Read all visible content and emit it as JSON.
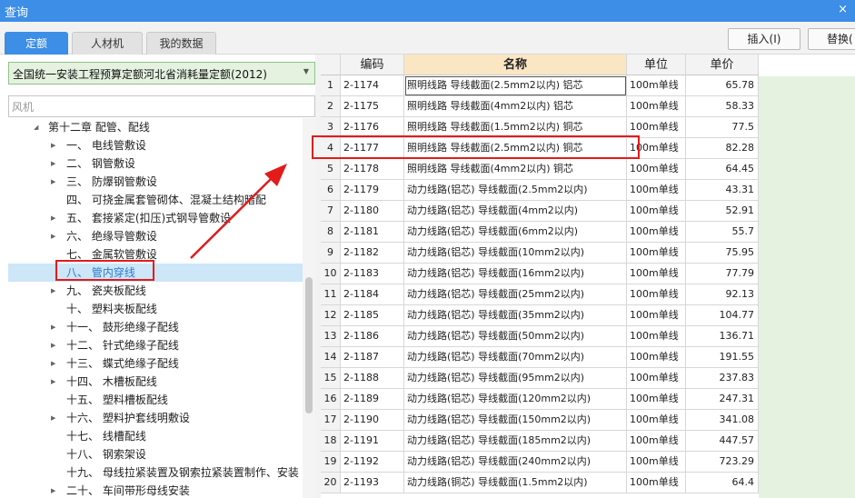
{
  "window": {
    "title": "查询",
    "close_glyph": "×"
  },
  "tabs": [
    {
      "label": "定额",
      "active": true
    },
    {
      "label": "人材机",
      "active": false
    },
    {
      "label": "我的数据",
      "active": false
    }
  ],
  "toolbar": {
    "insert_label": "插入(I)",
    "replace_label": "替换("
  },
  "quota_select": {
    "value": "全国统一安装工程预算定额河北省消耗量定额(2012)"
  },
  "search": {
    "placeholder": "风机"
  },
  "tree": {
    "chapter": "第十二章 配管、配线",
    "items": [
      {
        "label": "一、 电线管敷设",
        "expandable": true
      },
      {
        "label": "二、 钢管敷设",
        "expandable": true
      },
      {
        "label": "三、 防爆钢管敷设",
        "expandable": true
      },
      {
        "label": "四、 可挠金属套管砌体、混凝土结构暗配",
        "expandable": false
      },
      {
        "label": "五、 套接紧定(扣压)式钢导管敷设",
        "expandable": true
      },
      {
        "label": "六、 绝缘导管敷设",
        "expandable": true
      },
      {
        "label": "七、 金属软管敷设",
        "expandable": false
      },
      {
        "label": "八、 管内穿线",
        "expandable": false,
        "selected": true
      },
      {
        "label": "九、 瓷夹板配线",
        "expandable": true
      },
      {
        "label": "十、 塑料夹板配线",
        "expandable": false
      },
      {
        "label": "十一、 鼓形绝缘子配线",
        "expandable": true
      },
      {
        "label": "十二、 针式绝缘子配线",
        "expandable": true
      },
      {
        "label": "十三、 蝶式绝缘子配线",
        "expandable": true
      },
      {
        "label": "十四、 木槽板配线",
        "expandable": true
      },
      {
        "label": "十五、 塑料槽板配线",
        "expandable": false
      },
      {
        "label": "十六、 塑料护套线明敷设",
        "expandable": true
      },
      {
        "label": "十七、 线槽配线",
        "expandable": false
      },
      {
        "label": "十八、 钢索架设",
        "expandable": false
      },
      {
        "label": "十九、 母线拉紧装置及钢索拉紧装置制作、安装",
        "expandable": false
      },
      {
        "label": "二十、 车间带形母线安装",
        "expandable": true
      }
    ]
  },
  "grid": {
    "columns": {
      "code": "编码",
      "name": "名称",
      "unit": "单位",
      "price": "单价"
    },
    "rows": [
      {
        "n": "1",
        "code": "2-1174",
        "name": "照明线路 导线截面(2.5mm2以内) 铝芯",
        "unit": "100m单线",
        "price": "65.78",
        "selected": true
      },
      {
        "n": "2",
        "code": "2-1175",
        "name": "照明线路 导线截面(4mm2以内) 铝芯",
        "unit": "100m单线",
        "price": "58.33"
      },
      {
        "n": "3",
        "code": "2-1176",
        "name": "照明线路 导线截面(1.5mm2以内) 铜芯",
        "unit": "100m单线",
        "price": "77.5"
      },
      {
        "n": "4",
        "code": "2-1177",
        "name": "照明线路 导线截面(2.5mm2以内) 铜芯",
        "unit": "100m单线",
        "price": "82.28"
      },
      {
        "n": "5",
        "code": "2-1178",
        "name": "照明线路 导线截面(4mm2以内) 铜芯",
        "unit": "100m单线",
        "price": "64.45"
      },
      {
        "n": "6",
        "code": "2-1179",
        "name": "动力线路(铝芯) 导线截面(2.5mm2以内)",
        "unit": "100m单线",
        "price": "43.31"
      },
      {
        "n": "7",
        "code": "2-1180",
        "name": "动力线路(铝芯) 导线截面(4mm2以内)",
        "unit": "100m单线",
        "price": "52.91"
      },
      {
        "n": "8",
        "code": "2-1181",
        "name": "动力线路(铝芯) 导线截面(6mm2以内)",
        "unit": "100m单线",
        "price": "55.7"
      },
      {
        "n": "9",
        "code": "2-1182",
        "name": "动力线路(铝芯) 导线截面(10mm2以内)",
        "unit": "100m单线",
        "price": "75.95"
      },
      {
        "n": "10",
        "code": "2-1183",
        "name": "动力线路(铝芯) 导线截面(16mm2以内)",
        "unit": "100m单线",
        "price": "77.79"
      },
      {
        "n": "11",
        "code": "2-1184",
        "name": "动力线路(铝芯) 导线截面(25mm2以内)",
        "unit": "100m单线",
        "price": "92.13"
      },
      {
        "n": "12",
        "code": "2-1185",
        "name": "动力线路(铝芯) 导线截面(35mm2以内)",
        "unit": "100m单线",
        "price": "104.77"
      },
      {
        "n": "13",
        "code": "2-1186",
        "name": "动力线路(铝芯) 导线截面(50mm2以内)",
        "unit": "100m单线",
        "price": "136.71"
      },
      {
        "n": "14",
        "code": "2-1187",
        "name": "动力线路(铝芯) 导线截面(70mm2以内)",
        "unit": "100m单线",
        "price": "191.55"
      },
      {
        "n": "15",
        "code": "2-1188",
        "name": "动力线路(铝芯) 导线截面(95mm2以内)",
        "unit": "100m单线",
        "price": "237.83"
      },
      {
        "n": "16",
        "code": "2-1189",
        "name": "动力线路(铝芯) 导线截面(120mm2以内)",
        "unit": "100m单线",
        "price": "247.31"
      },
      {
        "n": "17",
        "code": "2-1190",
        "name": "动力线路(铝芯) 导线截面(150mm2以内)",
        "unit": "100m单线",
        "price": "341.08"
      },
      {
        "n": "18",
        "code": "2-1191",
        "name": "动力线路(铝芯) 导线截面(185mm2以内)",
        "unit": "100m单线",
        "price": "447.57"
      },
      {
        "n": "19",
        "code": "2-1192",
        "name": "动力线路(铝芯) 导线截面(240mm2以内)",
        "unit": "100m单线",
        "price": "723.29"
      },
      {
        "n": "20",
        "code": "2-1193",
        "name": "动力线路(铜芯) 导线截面(1.5mm2以内)",
        "unit": "100m单线",
        "price": "64.4"
      }
    ]
  },
  "annotations": {
    "color": "#e21b1b"
  }
}
